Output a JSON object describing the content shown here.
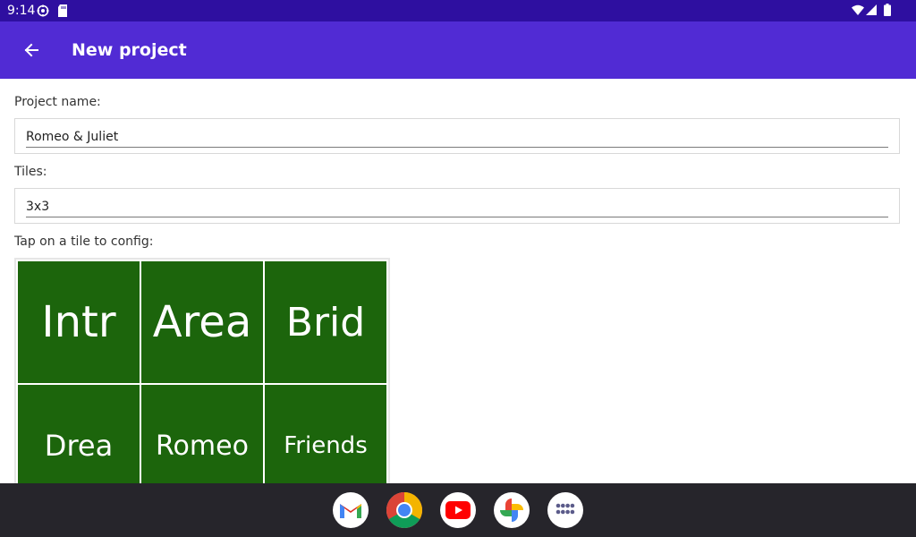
{
  "status_bar": {
    "time": "9:14"
  },
  "app_bar": {
    "title": "New project"
  },
  "form": {
    "project_name_label": "Project name:",
    "project_name_value": "Romeo & Juliet",
    "tiles_label": "Tiles:",
    "tiles_value": "3x3",
    "grid_hint": "Tap on a tile to config:"
  },
  "tiles": [
    "Intr",
    "Area",
    "Brid",
    "Drea",
    "Romeo",
    "Friends"
  ],
  "colors": {
    "status_bar": "#2e0fa0",
    "app_bar": "#512bd4",
    "tile": "#1c650c",
    "taskbar": "#26252b"
  },
  "dock": [
    "gmail-icon",
    "chrome-icon",
    "youtube-icon",
    "photos-icon",
    "app-drawer-icon"
  ]
}
